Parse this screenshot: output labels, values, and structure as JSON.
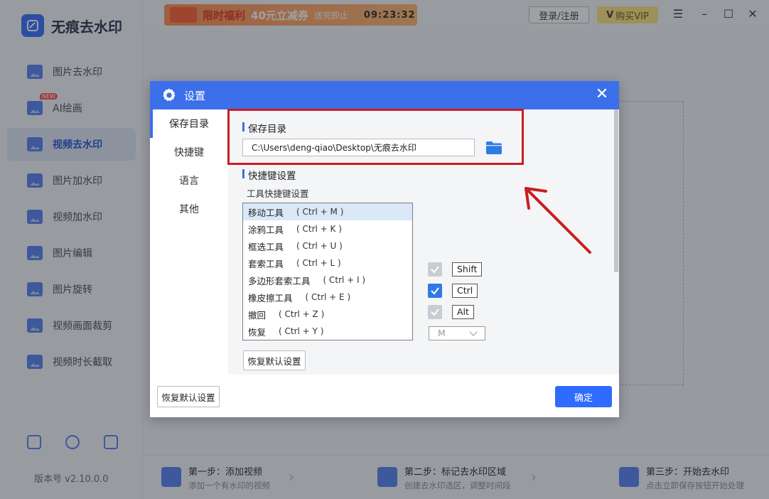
{
  "app": {
    "name": "无痕去水印",
    "version": "版本号 v2.10.0.0",
    "nav": [
      {
        "label": "图片去水印",
        "active": false
      },
      {
        "label": "AI绘画",
        "active": false,
        "badge": "NEW"
      },
      {
        "label": "视频去水印",
        "active": true
      },
      {
        "label": "图片加水印",
        "active": false
      },
      {
        "label": "视频加水印",
        "active": false
      },
      {
        "label": "图片编辑",
        "active": false
      },
      {
        "label": "图片旋转",
        "active": false
      },
      {
        "label": "视频画面裁剪",
        "active": false
      },
      {
        "label": "视频时长截取",
        "active": false
      }
    ]
  },
  "topbar": {
    "promo_title": "限时福利",
    "promo_amount": "40元立减券",
    "promo_note": "送完即止",
    "promo_timer": "09:23:32",
    "login_label": "登录/注册",
    "vip_label": "购买VIP"
  },
  "steps": [
    {
      "title": "第一步：添加视频",
      "desc": "添加一个有水印的视频"
    },
    {
      "title": "第二步：标记去水印区域",
      "desc": "创建去水印选区，调整时间段"
    },
    {
      "title": "第三步：开始去水印",
      "desc": "点击立即保存按钮开始处理"
    }
  ],
  "dialog": {
    "title": "设置",
    "tabs": [
      {
        "label": "保存目录",
        "active": true
      },
      {
        "label": "快捷键",
        "active": false
      },
      {
        "label": "语言",
        "active": false
      },
      {
        "label": "其他",
        "active": false
      }
    ],
    "save_dir": {
      "section_title": "保存目录",
      "path": "C:\\Users\\deng-qiao\\Desktop\\无痕去水印"
    },
    "shortcuts": {
      "section_title": "快捷键设置",
      "sub_label": "工具快捷键设置",
      "tools": [
        {
          "name": "移动工具",
          "key": "( Ctrl + M )",
          "selected": true
        },
        {
          "name": "涂鸦工具",
          "key": "( Ctrl + K )",
          "selected": false
        },
        {
          "name": "框选工具",
          "key": "( Ctrl + U )",
          "selected": false
        },
        {
          "name": "套索工具",
          "key": "( Ctrl + L )",
          "selected": false
        },
        {
          "name": "多边形套索工具",
          "key": "( Ctrl + I )",
          "selected": false
        },
        {
          "name": "橡皮擦工具",
          "key": "( Ctrl + E )",
          "selected": false
        },
        {
          "name": "撤回",
          "key": "( Ctrl + Z )",
          "selected": false
        },
        {
          "name": "恢复",
          "key": "( Ctrl + Y )",
          "selected": false
        }
      ],
      "modifiers": [
        {
          "label": "Shift",
          "checked": false
        },
        {
          "label": "Ctrl",
          "checked": true
        },
        {
          "label": "Alt",
          "checked": false
        }
      ],
      "key_value": "M",
      "reset_label": "恢复默认设置"
    },
    "footer_reset_label": "恢复默认设置",
    "ok_label": "确定"
  },
  "colors": {
    "primary": "#3c6fea",
    "highlight": "#c81f1f",
    "checked": "#2f7be6"
  }
}
